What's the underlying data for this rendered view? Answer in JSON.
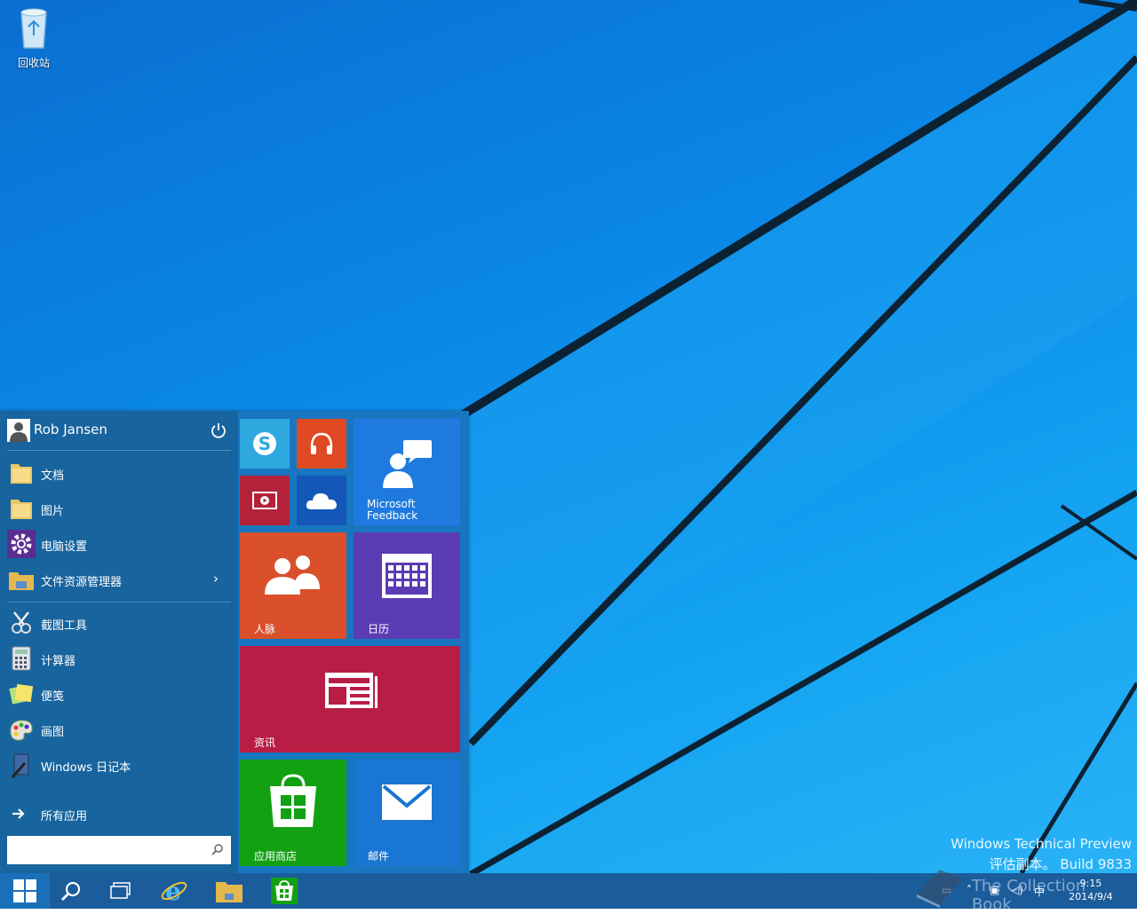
{
  "desktop": {
    "recycle_bin_label": "回收站",
    "watermark": {
      "line1": "Windows Technical Preview",
      "line2": "评估副本。 Build 9833"
    }
  },
  "start_menu": {
    "user_name": "Rob Jansen",
    "places": [
      {
        "label": "文档",
        "icon": "folder-icon"
      },
      {
        "label": "图片",
        "icon": "folder-icon"
      },
      {
        "label": "电脑设置",
        "icon": "gear-icon"
      },
      {
        "label": "文件资源管理器",
        "icon": "file-explorer-icon"
      }
    ],
    "recent": [
      {
        "label": "截图工具",
        "icon": "snipping-tool-icon"
      },
      {
        "label": "计算器",
        "icon": "calculator-icon"
      },
      {
        "label": "便笺",
        "icon": "sticky-notes-icon"
      },
      {
        "label": "画图",
        "icon": "paint-icon"
      },
      {
        "label": "Windows 日记本",
        "icon": "journal-icon"
      }
    ],
    "all_apps": "所有应用",
    "search_placeholder": ""
  },
  "tiles": {
    "skype": {
      "icon": "skype-icon",
      "color": "#2fa8e0"
    },
    "music": {
      "icon": "headphones-icon",
      "color": "#e04a22"
    },
    "video": {
      "icon": "video-icon",
      "color": "#b4223a"
    },
    "onedrive": {
      "icon": "cloud-icon",
      "color": "#1357b8"
    },
    "feedback": {
      "label1": "Microsoft",
      "label2": "Feedback",
      "color": "#1f7ae0"
    },
    "people": {
      "label": "人脉",
      "color": "#d9502a"
    },
    "calendar": {
      "label": "日历",
      "color": "#5b3cb4"
    },
    "news": {
      "label": "资讯",
      "color": "#b81e45"
    },
    "store": {
      "label": "应用商店",
      "color": "#12a112"
    },
    "mail": {
      "label": "邮件",
      "color": "#1976d2"
    }
  },
  "taskbar": {
    "buttons": [
      "start-button",
      "search-button",
      "task-view-button",
      "internet-explorer-button",
      "file-explorer-button",
      "store-button"
    ],
    "tray_ime": "中",
    "clock_time": "9:15",
    "clock_date": "2014/9/4"
  },
  "overlay": {
    "text": "The Collection Book"
  }
}
